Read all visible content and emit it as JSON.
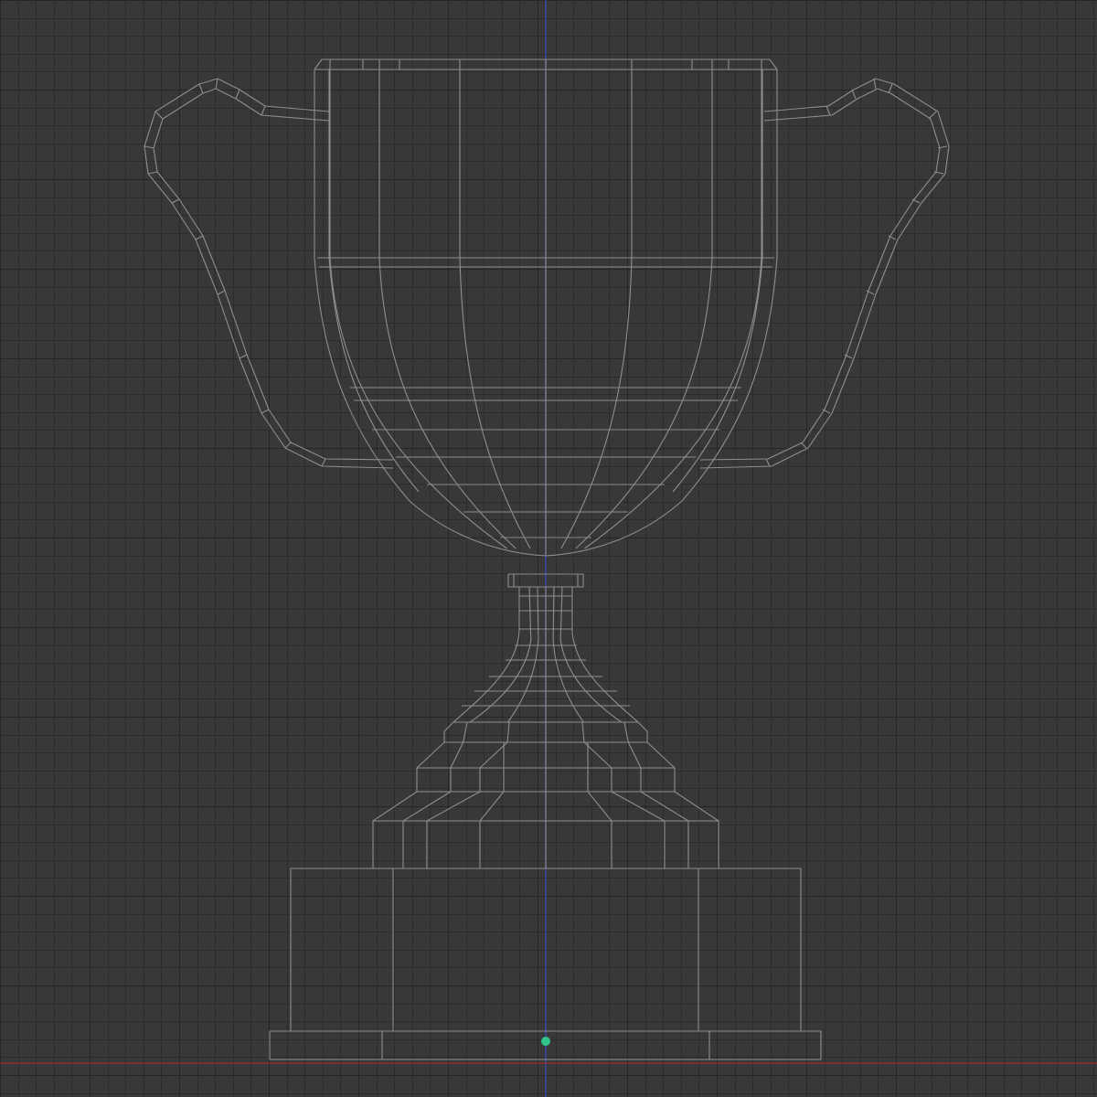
{
  "viewport": {
    "view": "front-orthographic",
    "display_mode": "wireframe",
    "object": "trophy-cup-mesh"
  },
  "colors": {
    "background": "#383838",
    "grid_minor": "#2c2c2c",
    "grid_major": "#262626",
    "wire": "#8e8e8e",
    "axis_vertical": "#3a4bb8",
    "axis_horizontal": "#9a2d2d",
    "origin": "#2fc48a"
  },
  "grid": {
    "visible": true
  }
}
